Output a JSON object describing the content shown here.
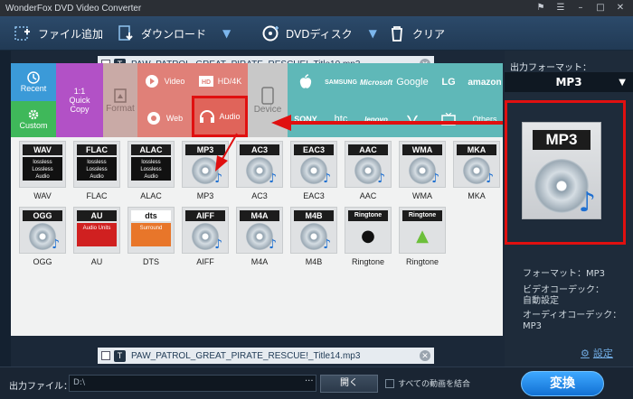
{
  "app": {
    "title": "WonderFox DVD Video Converter"
  },
  "window_controls": [
    "⚑",
    "☰",
    "–",
    "□",
    "✕"
  ],
  "toolbar": {
    "add_file": "ファイル追加",
    "download": "ダウンロード",
    "dvd_disc": "DVDディスク",
    "clear": "クリア"
  },
  "files": [
    {
      "name": "PAW_PATROL_GREAT_PIRATE_RESCUE!_Title10.mp3"
    },
    {
      "name": "PAW_PATROL_GREAT_PIRATE_RESCUE!_Title14.mp3"
    }
  ],
  "format_panel": {
    "categories": {
      "recent": "Recent",
      "custom": "Custom",
      "quick_copy": "1:1\nQuick\nCopy",
      "format": "Format",
      "video": "Video",
      "hd4k": "HD/4K",
      "web": "Web",
      "audio": "Audio",
      "device": "Device"
    },
    "brands": [
      "",
      "SAMSUNG",
      "Microsoft",
      "Google",
      "LG",
      "amazon",
      "SONY",
      "htc",
      "lenovo",
      "",
      "TV",
      "Others"
    ],
    "formats": [
      {
        "tag": "WAV",
        "badge": "lossless\nLossless\nAudio",
        "label": "WAV"
      },
      {
        "tag": "FLAC",
        "badge": "lossless\nLossless\nAudio",
        "label": "FLAC"
      },
      {
        "tag": "ALAC",
        "badge": "lossless\nLossless\nAudio",
        "label": "ALAC"
      },
      {
        "tag": "MP3",
        "badge": "",
        "label": "MP3"
      },
      {
        "tag": "AC3",
        "badge": "",
        "label": "AC3"
      },
      {
        "tag": "EAC3",
        "badge": "",
        "label": "EAC3"
      },
      {
        "tag": "AAC",
        "badge": "",
        "label": "AAC"
      },
      {
        "tag": "WMA",
        "badge": "",
        "label": "WMA"
      },
      {
        "tag": "MKA",
        "badge": "",
        "label": "MKA"
      },
      {
        "tag": "OGG",
        "badge": "",
        "label": "OGG"
      },
      {
        "tag": "AU",
        "badge": "Audio Units",
        "label": "AU"
      },
      {
        "tag": "dts",
        "badge": "Surround",
        "label": "DTS"
      },
      {
        "tag": "AIFF",
        "badge": "",
        "label": "AIFF"
      },
      {
        "tag": "M4A",
        "badge": "",
        "label": "M4A"
      },
      {
        "tag": "M4B",
        "badge": "",
        "label": "M4B"
      },
      {
        "tag": "Ringtone",
        "badge": "",
        "label": "Ringtone"
      },
      {
        "tag": "Ringtone",
        "badge": "",
        "label": "Ringtone"
      }
    ]
  },
  "output": {
    "header": "出力フォーマット：",
    "selected": "MP3",
    "preview_tag": "MP3",
    "format_line": "フォーマット：MP3",
    "video_codec_label": "ビデオコーデック：",
    "video_codec_value": "自動設定",
    "audio_codec_label": "オーディオコーデック：",
    "audio_codec_value": "MP3",
    "settings": "設定"
  },
  "bottom": {
    "output_file_label": "出力ファイル：",
    "path": "D:\\",
    "browse": "···",
    "open": "開く",
    "merge_label": "すべての動画を結合",
    "convert": "変換"
  },
  "colors": {
    "accent_red": "#e01010",
    "teal": "#5fb8b8",
    "audio_red": "#e0645a",
    "convert_blue": "#1a86f0"
  }
}
